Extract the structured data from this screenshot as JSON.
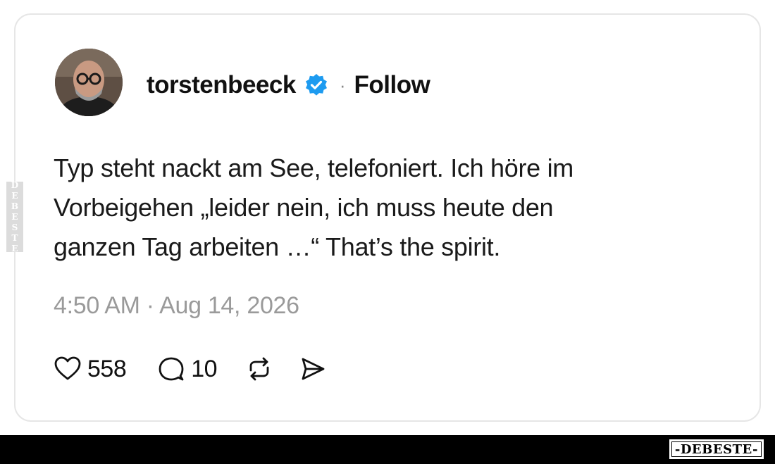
{
  "post": {
    "username": "torstenbeeck",
    "separator": "·",
    "follow_label": "Follow",
    "verified_icon": "verified-badge-icon",
    "text_lines": [
      "Typ steht nackt am See, telefoniert. Ich höre im",
      "Vorbeigehen „leider nein, ich muss heute den",
      "ganzen Tag arbeiten …“ That’s the spirit."
    ],
    "timestamp": "4:50 AM · Aug 14, 2026",
    "likes": "558",
    "replies": "10"
  },
  "icons": {
    "like": "heart-icon",
    "reply": "speech-bubble-icon",
    "repost": "repost-icon",
    "share": "send-icon"
  },
  "watermark": {
    "side_text": "DEBESTE",
    "logo_text": "-DEBESTE-"
  },
  "colors": {
    "verified_blue": "#1d9bf0",
    "timestamp_gray": "#9a9a9a",
    "card_border": "#e6e6e6",
    "bottom_bar": "#000000"
  }
}
